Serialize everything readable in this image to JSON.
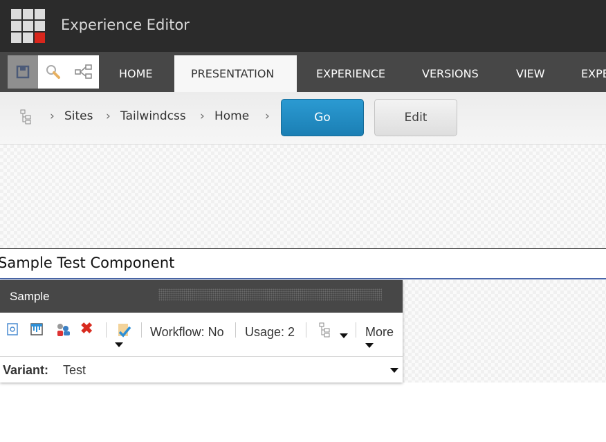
{
  "app": {
    "title": "Experience Editor"
  },
  "ribbon": {
    "tabs": [
      {
        "label": "HOME"
      },
      {
        "label": "PRESENTATION",
        "active": true
      },
      {
        "label": "EXPERIENCE"
      },
      {
        "label": "VERSIONS"
      },
      {
        "label": "VIEW"
      },
      {
        "label": "EXPE"
      }
    ],
    "quick_actions": [
      "save-icon",
      "search-icon",
      "navigation-tree-icon"
    ]
  },
  "breadcrumb": {
    "items": [
      "Sites",
      "Tailwindcss",
      "Home"
    ],
    "go_label": "Go",
    "edit_label": "Edit"
  },
  "component": {
    "name": "Sample Test Component"
  },
  "panel": {
    "title": "Sample",
    "workflow": "Workflow: No",
    "usage": "Usage: 2",
    "more": "More",
    "variant_label": "Variant:",
    "variant_value": "Test"
  },
  "colors": {
    "accent": "#1f86bd",
    "logo_red": "#d9261c"
  }
}
